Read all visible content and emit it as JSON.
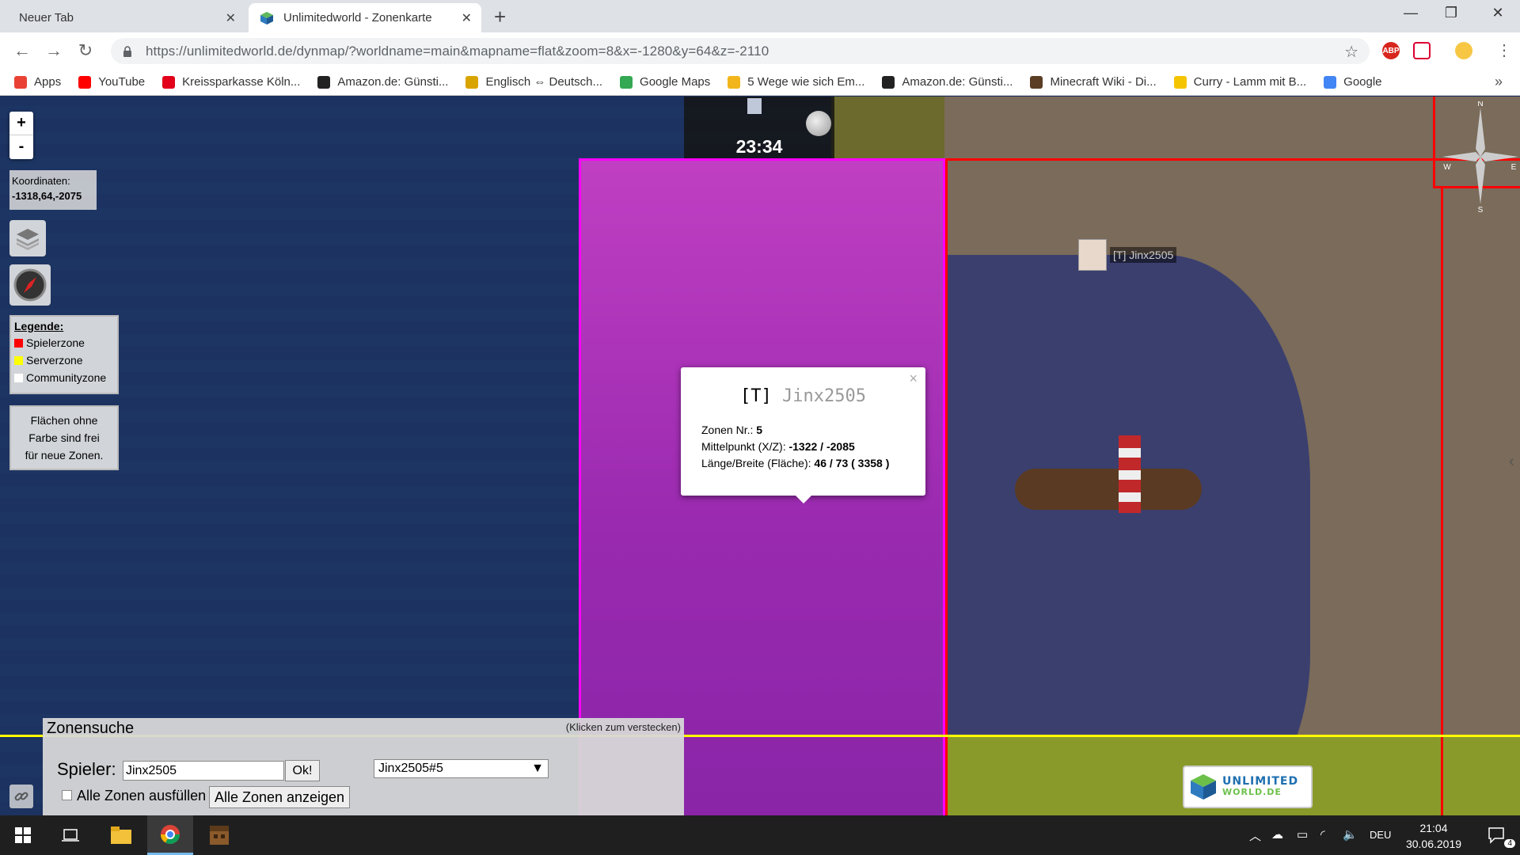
{
  "browser": {
    "tabs": [
      {
        "title": "Neuer Tab"
      },
      {
        "title": "Unlimitedworld - Zonenkarte"
      }
    ],
    "url_host": "https://unlimitedworld.de",
    "url_path": "/dynmap/?worldname=main&mapname=flat&zoom=8&x=-1280&y=64&z=-2110",
    "extension_abp": "ABP",
    "bookmarks": [
      {
        "label": "Apps",
        "icon": "apps-grid-icon",
        "color": "#e94235"
      },
      {
        "label": "YouTube",
        "icon": "youtube-icon",
        "color": "#ff0000"
      },
      {
        "label": "Kreissparkasse Köln...",
        "icon": "sparkasse-icon",
        "color": "#e2001a"
      },
      {
        "label": "Amazon.de: Günsti...",
        "icon": "amazon-icon",
        "color": "#222222"
      },
      {
        "label": "Englisch ⇔ Deutsch...",
        "icon": "dictionary-icon",
        "color": "#d9a400"
      },
      {
        "label": "Google Maps",
        "icon": "google-maps-icon",
        "color": "#34a853"
      },
      {
        "label": "5 Wege wie sich Em...",
        "icon": "coin-icon",
        "color": "#f2b51b"
      },
      {
        "label": "Amazon.de: Günsti...",
        "icon": "amazon-icon",
        "color": "#222222"
      },
      {
        "label": "Minecraft Wiki - Di...",
        "icon": "minecraft-icon",
        "color": "#5a3d23"
      },
      {
        "label": "Curry - Lamm mit B...",
        "icon": "radiation-icon",
        "color": "#f5c400"
      },
      {
        "label": "Google",
        "icon": "google-icon",
        "color": "#4285f4"
      }
    ],
    "bookmark_overflow": "»"
  },
  "map": {
    "zoom_in": "+",
    "zoom_out": "-",
    "coordinates_label": "Koordinaten:",
    "coordinates_value": "-1318,64,-2075",
    "clock_time": "23:34",
    "legend": {
      "title": "Legende:",
      "items": [
        {
          "label": "Spielerzone",
          "color": "#ff0000"
        },
        {
          "label": "Serverzone",
          "color": "#ffff00"
        },
        {
          "label": "Communityzone",
          "color": "#ffffff"
        }
      ]
    },
    "free_info": [
      "Flächen ohne",
      "Farbe sind frei",
      "für neue Zonen."
    ],
    "player_marker": "[T] Jinx2505",
    "compass": {
      "n": "N",
      "e": "E",
      "s": "S",
      "w": "W"
    },
    "popup": {
      "title_tag": "[T]",
      "title_name": "Jinx2505",
      "close": "×",
      "zone_label": "Zonen Nr.:",
      "zone_value": "5",
      "center_label": "Mittelpunkt (X/Z):",
      "center_value": "-1322 / -2085",
      "size_label": "Länge/Breite (Fläche):",
      "size_value": "46 / 73 ( 3358 )"
    },
    "zone_colors": {
      "community_zone": "#ff00ff",
      "player_zone": "#ff0000",
      "server_zone": "#ffff00"
    }
  },
  "zonesuche": {
    "title": "Zonensuche",
    "hide_hint": "(Klicken zum verstecken)",
    "player_label": "Spieler:",
    "player_value": "Jinx2505",
    "ok_label": "Ok!",
    "select_value": "Jinx2505#5",
    "fill_all_label": "Alle Zonen ausfüllen",
    "show_all_label": "Alle Zonen anzeigen"
  },
  "logo": {
    "line1": "UNLIMITED",
    "line2": "WORLD.DE"
  },
  "taskbar": {
    "language": "DEU",
    "time": "21:04",
    "date": "30.06.2019",
    "notifications": "4"
  }
}
